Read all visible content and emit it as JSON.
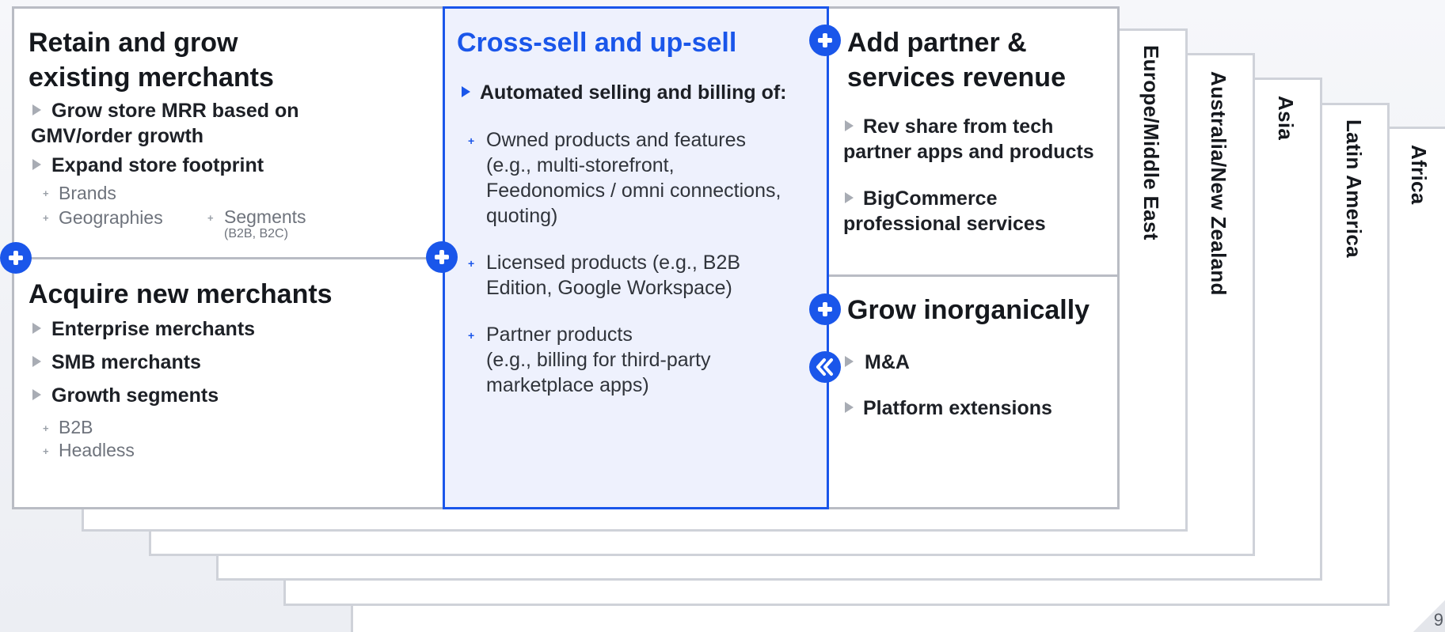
{
  "regions": {
    "emea": "Europe/Middle East",
    "anz": "Australia/New Zealand",
    "asia": "Asia",
    "latam": "Latin America",
    "africa": "Africa"
  },
  "retain": {
    "title_line1": "Retain and grow",
    "title_line2": "existing merchants",
    "bullet1_line1": "Grow store MRR based on",
    "bullet1_line2": "GMV/order growth",
    "bullet2": "Expand store footprint",
    "sub_brands": "Brands",
    "sub_geographies": "Geographies",
    "sub_segments": "Segments",
    "sub_segments_note": "(B2B, B2C)"
  },
  "acquire": {
    "title": "Acquire new merchants",
    "bullet1": "Enterprise merchants",
    "bullet2": "SMB merchants",
    "bullet3": "Growth segments",
    "sub_b2b": "B2B",
    "sub_headless": "Headless"
  },
  "crosssell": {
    "title": "Cross-sell and up-sell",
    "lead": "Automated selling and billing of:",
    "item1_line1": "Owned products and features",
    "item1_line2": "(e.g., multi-storefront,",
    "item1_line3": "Feedonomics / omni connections,",
    "item1_line4": "quoting)",
    "item2_line1": "Licensed products (e.g., B2B",
    "item2_line2": "Edition, Google Workspace)",
    "item3_line1": "Partner products",
    "item3_line2": "(e.g., billing for third-party",
    "item3_line3": "marketplace apps)"
  },
  "partner": {
    "title_line1": "Add partner &",
    "title_line2": "services revenue",
    "bullet1_line1": "Rev share from tech",
    "bullet1_line2": "partner apps and products",
    "bullet2_line1": "BigCommerce",
    "bullet2_line2": "professional services"
  },
  "inorganic": {
    "title": "Grow inorganically",
    "bullet1": "M&A",
    "bullet2": "Platform extensions"
  },
  "page_number": "9",
  "colors": {
    "accent": "#1a56ea",
    "highlight_fill": "#eef1fd",
    "border": "#b9bcc4"
  }
}
